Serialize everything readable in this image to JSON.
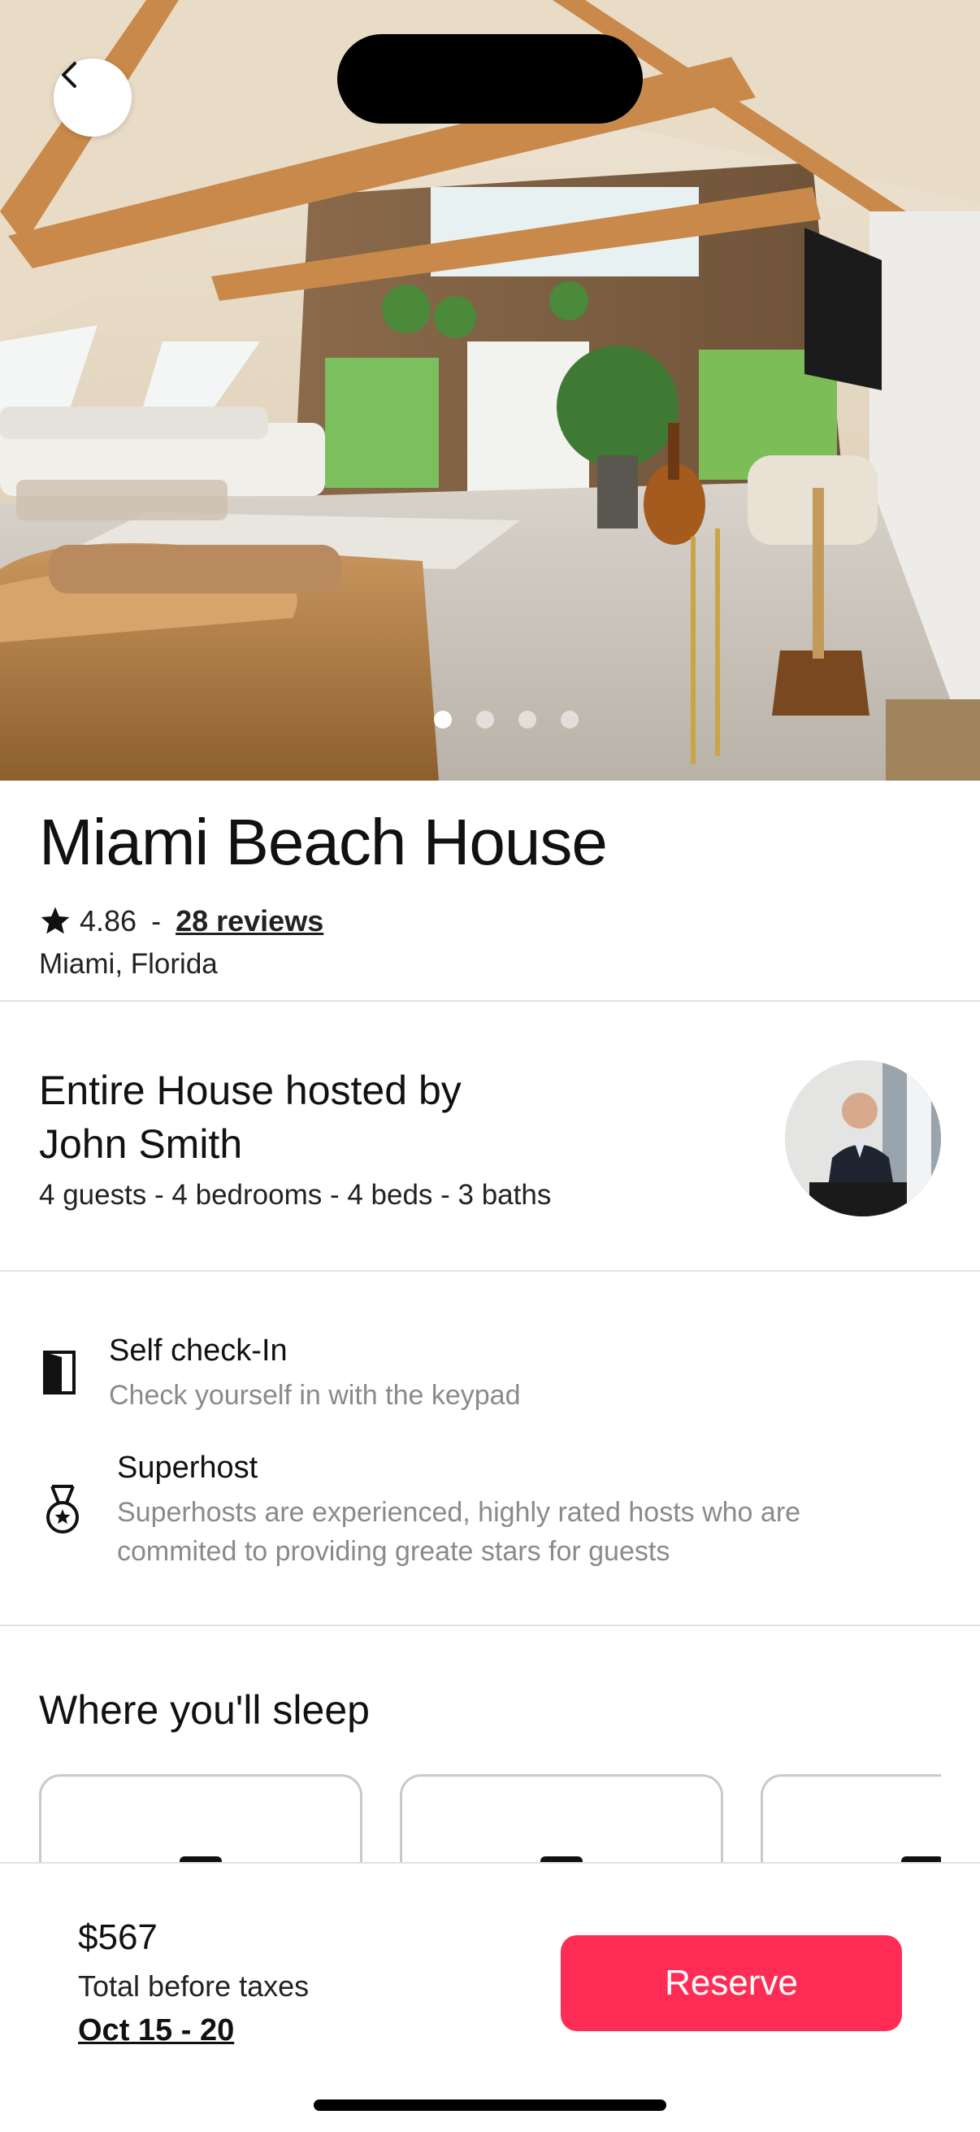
{
  "listing": {
    "title": "Miami Beach House",
    "rating": "4.86",
    "separator": "-",
    "reviews": "28 reviews",
    "location": "Miami, Florida"
  },
  "gallery": {
    "photo_count": 4,
    "active_index": 0
  },
  "host": {
    "title": "Entire House hosted by John Smith",
    "details": "4 guests - 4 bedrooms - 4 beds - 3 baths"
  },
  "features": [
    {
      "icon": "door-icon",
      "title": "Self check-In",
      "description": "Check yourself in with the keypad"
    },
    {
      "icon": "medal-icon",
      "title": "Superhost",
      "description": "Superhosts are experienced, highly rated hosts who are commited to providing greate stars for guests"
    }
  ],
  "sleep": {
    "title": "Where you'll sleep"
  },
  "footer": {
    "price": "$567",
    "price_note": "Total before taxes",
    "dates": "Oct 15 - 20",
    "reserve_label": "Reserve"
  },
  "colors": {
    "accent": "#ff2d55",
    "muted_text": "#8a8a8a",
    "divider": "#e2e2e2"
  }
}
